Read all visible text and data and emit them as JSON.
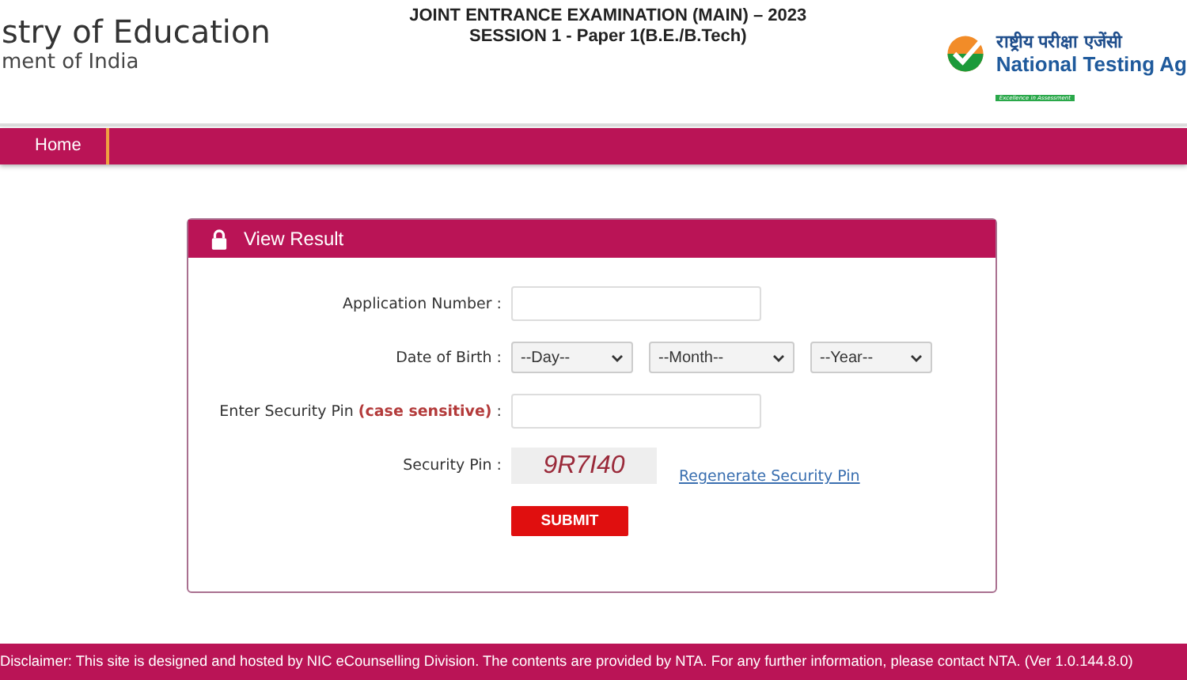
{
  "header": {
    "ministry": "stry of Education",
    "government": "ment of India",
    "exam_title": "JOINT ENTRANCE EXAMINATION (MAIN) – 2023",
    "session": "SESSION 1 - Paper 1(B.E./B.Tech)",
    "agency_hindi": "राष्ट्रीय परीक्षा एजेंसी",
    "agency_name": "National Testing Ag",
    "agency_tagline": "Excellence in Assessment"
  },
  "nav": [
    {
      "label": "Home",
      "selected": false
    }
  ],
  "form": {
    "title": "View Result",
    "fields": [
      {
        "kind": "text",
        "label": "Application Number :"
      },
      {
        "kind": "selects",
        "label": "Date of Birth :",
        "options": [
          "--Day--",
          "--Month--",
          "--Year--"
        ]
      },
      {
        "kind": "text",
        "label": "Enter Security Pin **(case sensitive)** :"
      },
      {
        "kind": "captcha",
        "label": "Security Pin :",
        "captcha": "9R7I40",
        "link": "Regenerate Security Pin"
      }
    ],
    "submit": "SUBMIT"
  },
  "footer": "Disclaimer: This site is designed and hosted by NIC eCounselling Division. The contents are provided by NTA. For any further information, please contact NTA. (Ver 1.0.144.8.0)"
}
